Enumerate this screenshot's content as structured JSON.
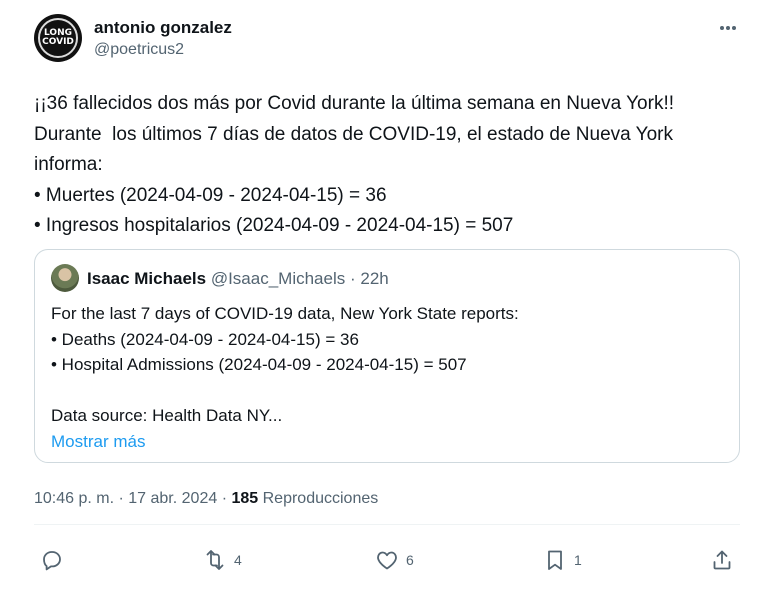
{
  "tweet": {
    "author": {
      "display_name": "antonio gonzalez",
      "handle": "@poetricus2",
      "avatar_text": "LONG COVID"
    },
    "text_lines": [
      "¡¡36 fallecidos dos más por Covid durante la última semana en Nueva York!!",
      "Durante  los últimos 7 días de datos de COVID-19, el estado de Nueva York",
      "informa:",
      "• Muertes (2024-04-09 - 2024-04-15) = 36",
      "• Ingresos hospitalarios (2024-04-09 - 2024-04-15) = 507"
    ],
    "quoted": {
      "display_name": "Isaac Michaels",
      "handle": "@Isaac_Michaels",
      "separator": "·",
      "time": "22h",
      "lines": [
        "For the last 7 days of COVID-19 data, New York State reports:",
        "• Deaths (2024-04-09 - 2024-04-15) = 36",
        "• Hospital Admissions (2024-04-09 - 2024-04-15) = 507",
        "",
        "Data source: Health Data NY..."
      ],
      "show_more": "Mostrar más"
    },
    "timestamp": "10:46 p. m. · 17 abr. 2024",
    "meta_separator": "·",
    "views_count": "185",
    "views_label": "Reproducciones",
    "actions": {
      "reply_count": "",
      "retweet_count": "4",
      "like_count": "6",
      "bookmark_count": "1"
    },
    "colors": {
      "text": "#0f1419",
      "secondary": "#536471",
      "link": "#1d9bf0",
      "border": "#cfd9de"
    }
  }
}
